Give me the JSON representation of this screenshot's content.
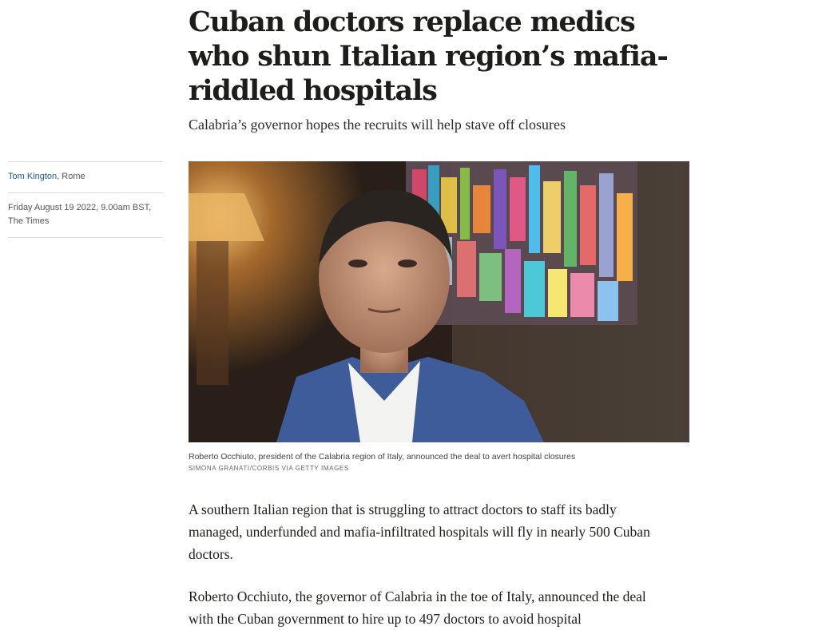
{
  "article": {
    "headline": "Cuban doctors replace medics who shun Italian region’s mafia-riddled hospitals",
    "standfirst": "Calabria’s governor hopes the recruits will help stave off closures",
    "author": "Tom Kington",
    "location": ", Rome",
    "date": "Friday August 19 2022, 9.00am BST,",
    "publication": "The Times",
    "image": {
      "caption": "Roberto Occhiuto, president of the Calabria region of Italy, announced the deal to avert hospital closures",
      "credit": "SIMONA GRANATI/CORBIS VIA GETTY IMAGES"
    },
    "paragraphs": [
      "A southern Italian region that is struggling to attract doctors to staff its badly managed, underfunded and mafia-infiltrated hospitals will fly in nearly 500 Cuban doctors.",
      "Roberto Occhiuto, the governor of Calabria in the toe of Italy, announced the deal with the Cuban government to hire up to 497 doctors to avoid hospital"
    ]
  },
  "colors": {
    "text": "#1d1d1b",
    "author_link": "#1f5a8a",
    "rule": "#dcdcdc"
  }
}
